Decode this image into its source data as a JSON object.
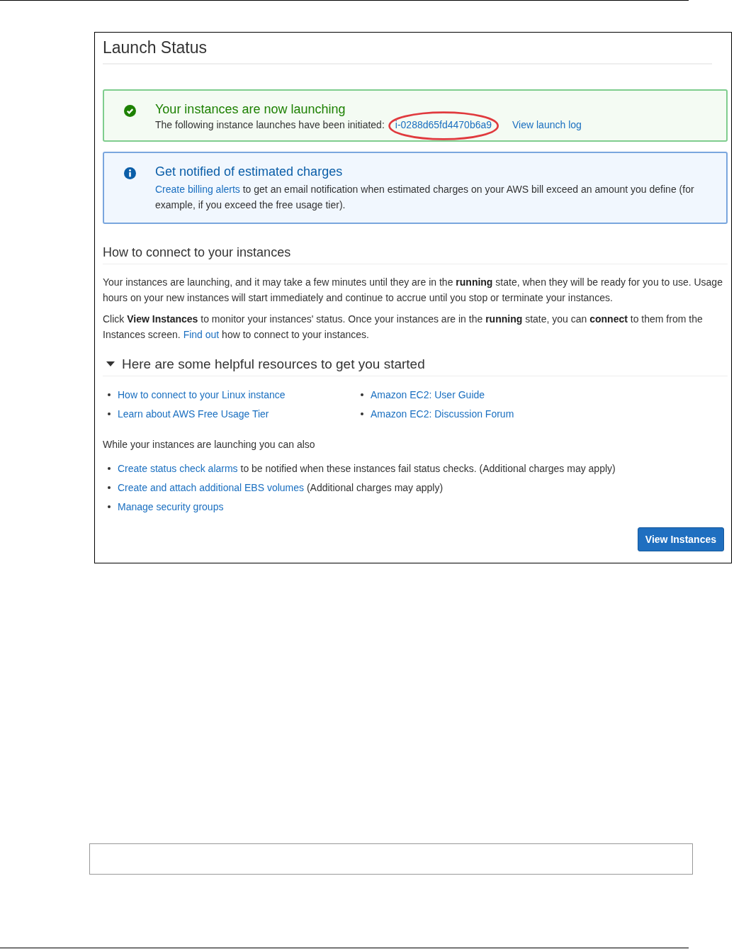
{
  "title": "Launch Status",
  "success_alert": {
    "title": "Your instances are now launching",
    "text": "The following instance launches have been initiated:",
    "instance_link": {
      "text": "i-0288d65fd4470b6a9",
      "circled": true
    },
    "log_link": "View launch log"
  },
  "info_alert": {
    "title": "Get notified of estimated charges",
    "parts": [
      {
        "kind": "link",
        "text": "Create billing alerts"
      },
      {
        "kind": "text",
        "text": " to get an email notification when estimated charges on your AWS bill exceed an amount you define (for example, if you exceed the free usage tier)."
      }
    ]
  },
  "connect_section": {
    "heading": "How to connect to your instances",
    "paragraphs": [
      [
        {
          "kind": "text",
          "text": "Your instances are launching, and it may take a few minutes until they are in the **running** state, when they will be ready for you to use. Usage hours on your new instances will start immediately and continue to accrue until you stop or terminate your instances."
        }
      ],
      [
        {
          "kind": "text",
          "text": "Click **View Instances** to monitor your instances' status. Once your instances are in the **running** state, you can **connect** to them from the Instances screen. "
        },
        {
          "kind": "link",
          "text": "Find out"
        },
        {
          "kind": "text",
          "text": " how to connect to your instances."
        }
      ]
    ]
  },
  "resources": {
    "heading": "Here are some helpful resources to get you started",
    "expanded": true,
    "columns": [
      [
        "How to connect to your Linux instance",
        "Learn about AWS Free Usage Tier"
      ],
      [
        "Amazon EC2: User Guide",
        "Amazon EC2: Discussion Forum"
      ]
    ]
  },
  "also": {
    "intro": "While your instances are launching you can also",
    "items": [
      [
        {
          "kind": "link",
          "text": "Create status check alarms"
        },
        {
          "kind": "text",
          "text": " to be notified when these instances fail status checks. (Additional charges may apply)"
        }
      ],
      [
        {
          "kind": "link",
          "text": "Create and attach additional EBS volumes"
        },
        {
          "kind": "text",
          "text": " (Additional charges may apply)"
        }
      ],
      [
        {
          "kind": "link",
          "text": "Manage security groups"
        }
      ]
    ]
  },
  "primary_button": "View Instances"
}
